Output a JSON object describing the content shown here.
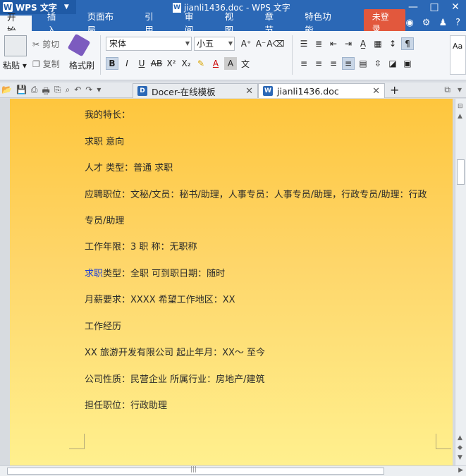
{
  "app": {
    "name": "WPS 文字",
    "window_title": "jianli1436.doc - WPS 文字"
  },
  "window_controls": {
    "minimize": "—",
    "maximize": "□",
    "close": "✕"
  },
  "ribbon_tabs": [
    "开始",
    "插入",
    "页面布局",
    "引用",
    "审阅",
    "视图",
    "章节",
    "特色功能"
  ],
  "login_label": "未登录",
  "ribbon": {
    "paste": "粘贴",
    "cut": "剪切",
    "copy": "复制",
    "format_painter": "格式刷",
    "font_name": "宋体",
    "font_size": "小五",
    "style_preview": "Aa"
  },
  "doc_tabs": [
    {
      "label": "Docer-在线模板",
      "icon_color": "#2b68b6"
    },
    {
      "label": "jianli1436.doc",
      "icon_color": "#2b68b6"
    }
  ],
  "document": {
    "lines": [
      "我的特长：",
      "求职 意向",
      "人才 类型：普通 求职",
      "应聘职位：文秘/文员：秘书/助理，人事专员：人事专员/助理，行政专员/助理：行政",
      "专员/助理",
      "工作年限：3                职       称：无职称",
      "类型：全职           可到职日期：随时",
      "月薪要求：XXXX            希望工作地区：XX",
      "工作经历",
      "XX 旅游开发有限公司         起止年月：XX～  至今",
      "公司性质：民营企业       所属行业：房地产/建筑",
      "担任职位：行政助理"
    ],
    "link_word": "求职"
  },
  "colors": {
    "title_bar": "#2b68b6",
    "page_top": "#fec63d",
    "page_bottom": "#fff08e",
    "login_btn": "#e2583d"
  }
}
